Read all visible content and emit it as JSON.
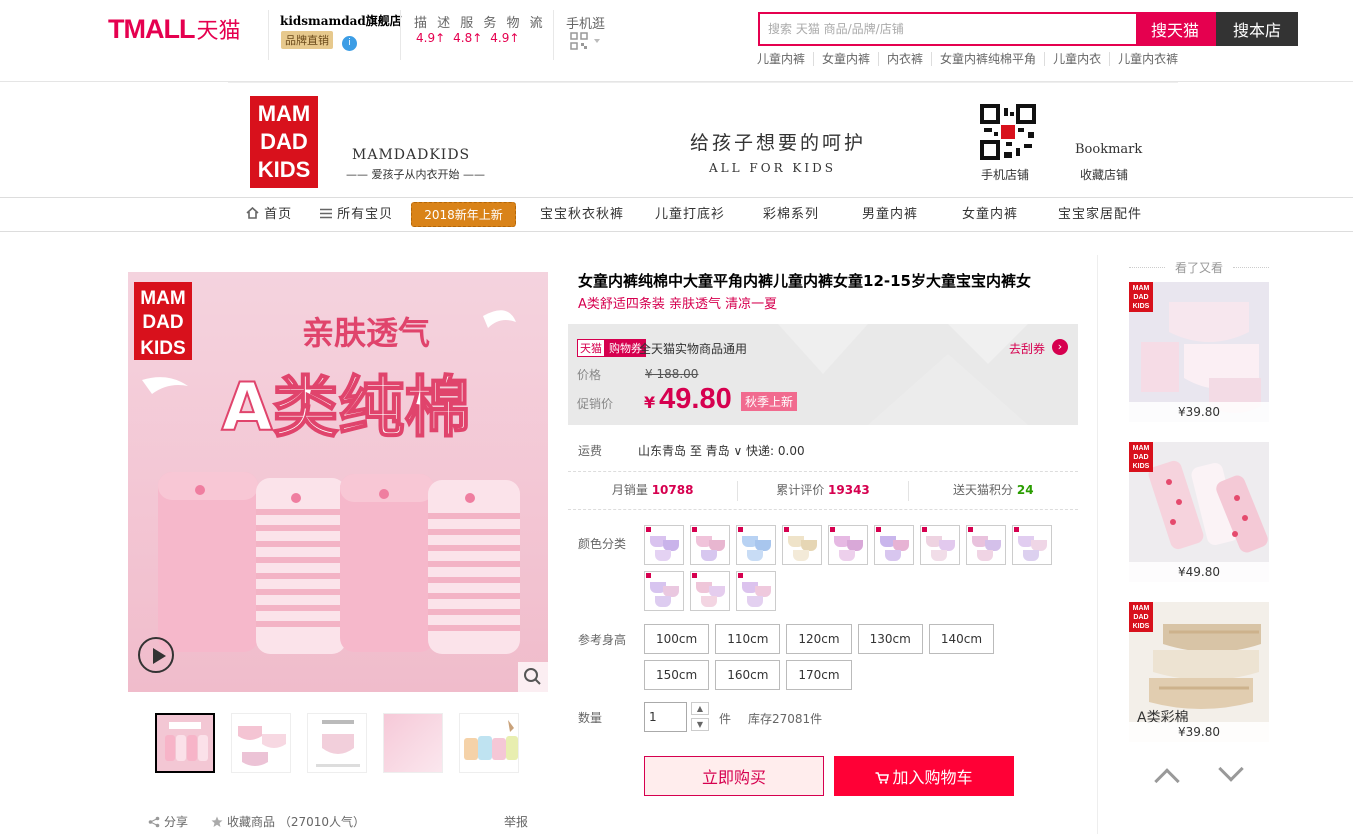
{
  "header": {
    "tmall_en": "TMALL",
    "tmall_cn": "天猫",
    "shop_name": "kidsmamdad旗舰店",
    "brand_tag": "品牌直销",
    "score_title": "描 述 服 务 物 流",
    "scores": [
      "4.9↑",
      "4.8↑",
      "4.9↑"
    ],
    "mobile_label": "手机逛",
    "search_placeholder": "搜索 天猫 商品/品牌/店铺",
    "search_tmall": "搜天猫",
    "search_shop": "搜本店",
    "hot_words": [
      "儿童内裤",
      "女童内裤",
      "内衣裤",
      "女童内裤纯棉平角",
      "儿童内衣",
      "儿童内衣裤"
    ]
  },
  "banner": {
    "logo_lines": [
      "MAM",
      "DAD",
      "KIDS"
    ],
    "shop_en": "MAMDADKIDS",
    "shop_slogan": "—— 爱孩子从内衣开始 ——",
    "motto_cn": "给孩子想要的呵护",
    "motto_en": "ALL FOR KIDS",
    "qr_label": "手机店铺",
    "bookmark_en": "Bookmark",
    "bookmark_cn": "收藏店铺"
  },
  "nav": {
    "home": "首页",
    "all": "所有宝贝",
    "promo": "2018新年上新",
    "items": [
      "宝宝秋衣秋裤",
      "儿童打底衫",
      "彩棉系列",
      "男童内裤",
      "女童内裤",
      "宝宝家居配件"
    ]
  },
  "gallery": {
    "image_logo": [
      "MAM",
      "DAD",
      "KIDS"
    ],
    "image_text_top": "亲肤透气",
    "image_text_main": "A类纯棉",
    "share": "分享",
    "favorite": "收藏商品 （27010人气）",
    "report": "举报"
  },
  "product": {
    "title": "女童内裤纯棉中大童平角内裤儿童内裤女童12-15岁大童宝宝内裤女",
    "subtitle": "A类舒适四条装 亲肤透气 清凉一夏",
    "coupon_tag_a": "天猫",
    "coupon_tag_b": "购物券",
    "coupon_text": "全天猫实物商品通用",
    "coupon_link": "去刮券",
    "price_label": "价格",
    "price_orig": "¥ 188.00",
    "promo_label": "促销价",
    "promo_currency": "¥",
    "promo_price": "49.80",
    "season_tag": "秋季上新",
    "shipping_label": "运费",
    "shipping_value": "山东青岛  至 青岛 ∨  快递: 0.00",
    "stats": {
      "sales_label": "月销量",
      "sales_value": "10788",
      "reviews_label": "累计评价",
      "reviews_value": "19343",
      "points_label": "送天猫积分",
      "points_value": "24"
    },
    "color_label": "颜色分类",
    "size_label": "参考身高",
    "sizes": [
      "100cm",
      "110cm",
      "120cm",
      "130cm",
      "140cm",
      "150cm",
      "160cm",
      "170cm"
    ],
    "qty_label": "数量",
    "qty_value": "1",
    "qty_unit": "件",
    "stock": "库存27081件",
    "buy_now": "立即购买",
    "add_cart": "加入购物车"
  },
  "see_also": {
    "title": "看了又看",
    "items": [
      {
        "price": "¥39.80"
      },
      {
        "price": "¥49.80"
      },
      {
        "price": "¥39.80",
        "caption": "A类彩棉"
      }
    ]
  },
  "colors": {
    "tmall_red": "#e5004f",
    "price_red": "#d6004f",
    "cart_red": "#ff0036",
    "promo_orange": "#d98319"
  }
}
